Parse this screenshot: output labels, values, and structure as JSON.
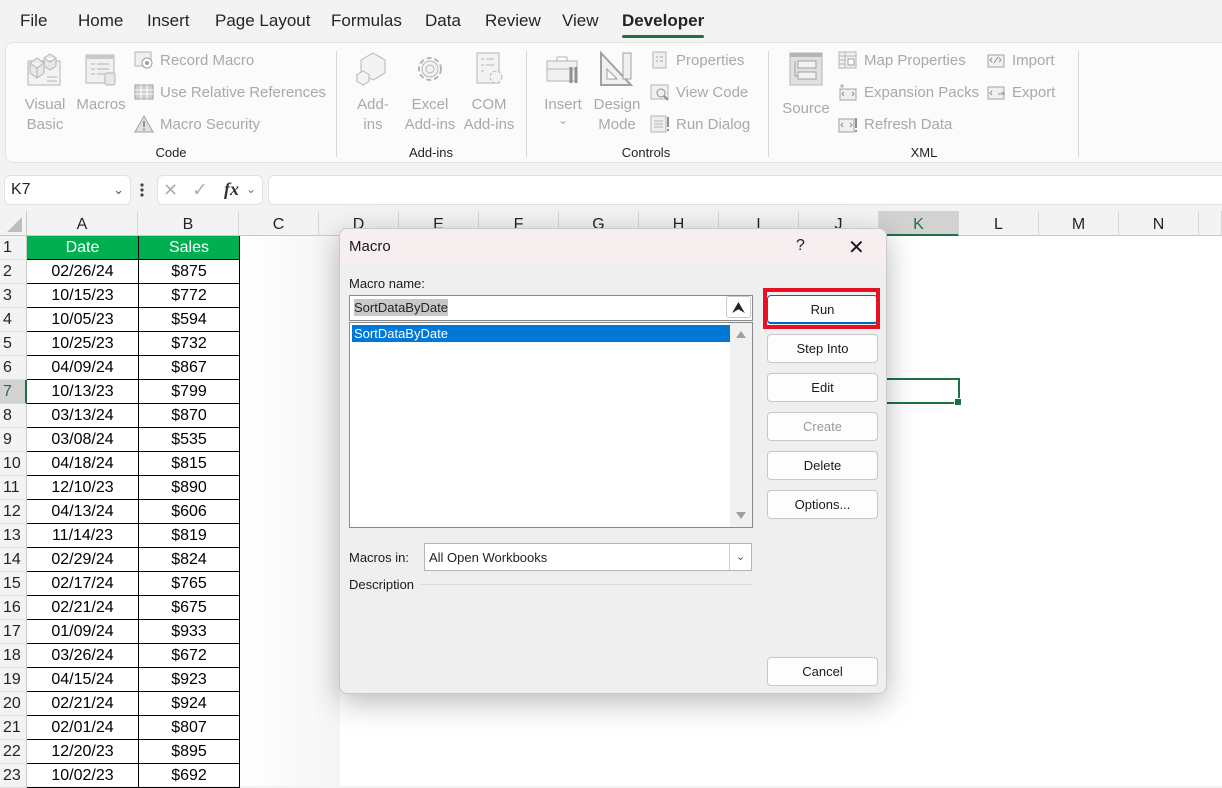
{
  "ribbon_tabs": [
    {
      "label": "File",
      "active": false
    },
    {
      "label": "Home",
      "active": false
    },
    {
      "label": "Insert",
      "active": false
    },
    {
      "label": "Page Layout",
      "active": false
    },
    {
      "label": "Formulas",
      "active": false
    },
    {
      "label": "Data",
      "active": false
    },
    {
      "label": "Review",
      "active": false
    },
    {
      "label": "View",
      "active": false
    },
    {
      "label": "Developer",
      "active": true
    }
  ],
  "ribbon": {
    "code": {
      "label": "Code",
      "visual_basic": [
        "Visual",
        "Basic"
      ],
      "macros": "Macros",
      "record_macro": "Record Macro",
      "use_relative": "Use Relative References",
      "macro_security": "Macro Security"
    },
    "addins": {
      "label": "Add-ins",
      "addins": [
        "Add-",
        "ins"
      ],
      "excel_addins": [
        "Excel",
        "Add-ins"
      ],
      "com_addins": [
        "COM",
        "Add-ins"
      ]
    },
    "controls": {
      "label": "Controls",
      "insert": "Insert",
      "insert_chevron": "⌄",
      "design_mode": [
        "Design",
        "Mode"
      ],
      "properties": "Properties",
      "view_code": "View Code",
      "run_dialog": "Run Dialog"
    },
    "xml": {
      "label": "XML",
      "source": "Source",
      "map_properties": "Map Properties",
      "expansion_packs": "Expansion Packs",
      "refresh_data": "Refresh Data",
      "import": "Import",
      "export": "Export"
    }
  },
  "formula_bar": {
    "name_box": "K7",
    "cancel_glyph": "✕",
    "enter_glyph": "✓",
    "fx": "fx",
    "formula": ""
  },
  "sheet": {
    "columns": [
      "A",
      "B",
      "C",
      "D",
      "E",
      "F",
      "G",
      "H",
      "I",
      "J",
      "K",
      "L",
      "M",
      "N"
    ],
    "selected_column": "K",
    "selected_row": 7,
    "header": {
      "a": "Date",
      "b": "Sales"
    },
    "rows": [
      {
        "n": "2",
        "date": "02/26/24",
        "sales": "$875"
      },
      {
        "n": "3",
        "date": "10/15/23",
        "sales": "$772"
      },
      {
        "n": "4",
        "date": "10/05/23",
        "sales": "$594"
      },
      {
        "n": "5",
        "date": "10/25/23",
        "sales": "$732"
      },
      {
        "n": "6",
        "date": "04/09/24",
        "sales": "$867"
      },
      {
        "n": "7",
        "date": "10/13/23",
        "sales": "$799"
      },
      {
        "n": "8",
        "date": "03/13/24",
        "sales": "$870"
      },
      {
        "n": "9",
        "date": "03/08/24",
        "sales": "$535"
      },
      {
        "n": "10",
        "date": "04/18/24",
        "sales": "$815"
      },
      {
        "n": "11",
        "date": "12/10/23",
        "sales": "$890"
      },
      {
        "n": "12",
        "date": "04/13/24",
        "sales": "$606"
      },
      {
        "n": "13",
        "date": "11/14/23",
        "sales": "$819"
      },
      {
        "n": "14",
        "date": "02/29/24",
        "sales": "$824"
      },
      {
        "n": "15",
        "date": "02/17/24",
        "sales": "$765"
      },
      {
        "n": "16",
        "date": "02/21/24",
        "sales": "$675"
      },
      {
        "n": "17",
        "date": "01/09/24",
        "sales": "$933"
      },
      {
        "n": "18",
        "date": "03/26/24",
        "sales": "$672"
      },
      {
        "n": "19",
        "date": "04/15/24",
        "sales": "$923"
      },
      {
        "n": "20",
        "date": "02/21/24",
        "sales": "$924"
      },
      {
        "n": "21",
        "date": "02/01/24",
        "sales": "$807"
      },
      {
        "n": "22",
        "date": "12/20/23",
        "sales": "$895"
      },
      {
        "n": "23",
        "date": "10/02/23",
        "sales": "$692"
      }
    ],
    "first_row_number": "1",
    "header_fill": "#00b050"
  },
  "dialog": {
    "title": "Macro",
    "help": "?",
    "close": "✕",
    "macro_name_label": "Macro name:",
    "macro_name_value": "SortDataByDate",
    "macro_list": [
      "SortDataByDate"
    ],
    "selected_macro": "SortDataByDate",
    "macros_in_label": "Macros in:",
    "macros_in_value": "All Open Workbooks",
    "description_label": "Description",
    "buttons": {
      "run": "Run",
      "step_into": "Step Into",
      "edit": "Edit",
      "create": "Create",
      "delete": "Delete",
      "options": "Options...",
      "cancel": "Cancel"
    },
    "highlight_color": "#e81123",
    "selection_color": "#0078d7"
  }
}
